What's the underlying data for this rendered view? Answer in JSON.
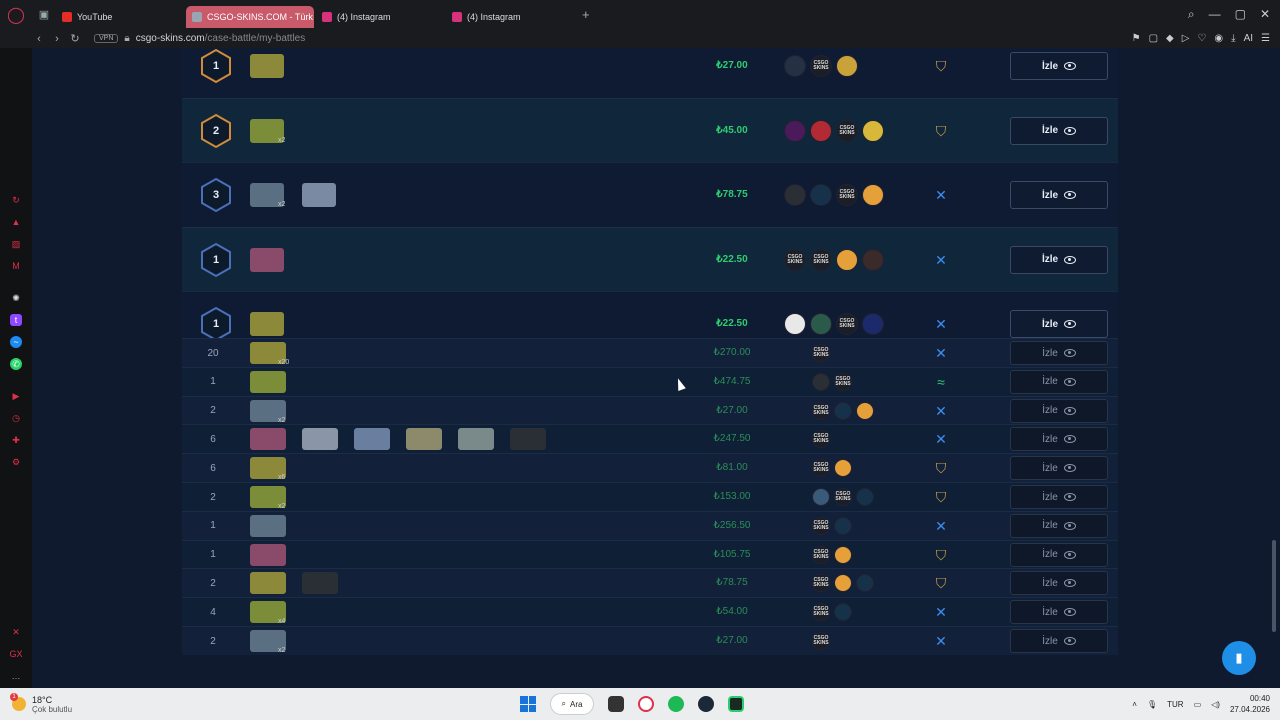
{
  "browser": {
    "tabs": [
      {
        "label": "YouTube",
        "fav": "#e52d27"
      },
      {
        "label": "CSGO-SKINS.COM - Türk",
        "fav": "#9aa5b4",
        "active": true
      },
      {
        "label": "(4) Instagram",
        "fav": "#d8327a"
      },
      {
        "label": "(4) Instagram",
        "fav": "#d8327a"
      }
    ],
    "vpn": "VPN",
    "url_host": "csgo-skins.com",
    "url_path": "/case-battle/my-battles",
    "ai_label": "AI"
  },
  "battles": {
    "button_label": "İzle",
    "featured": [
      {
        "level": "1",
        "price": "₺27.00",
        "mult": "",
        "mode": "gold",
        "avatars": [
          "#243043",
          "CSGO SKINS",
          "#c9a33a"
        ]
      },
      {
        "level": "2",
        "price": "₺45.00",
        "mult": "x2",
        "mode": "gold",
        "avatars": [
          "#4a1a5a",
          "#b22a33",
          "CSGO SKINS",
          "#d8b83a"
        ]
      },
      {
        "level": "3",
        "price": "₺78.75",
        "mult": "x2",
        "mode": "blue",
        "avatars": [
          "#2a2f36",
          "#16324a",
          "CSGO SKINS",
          "#e6a03a"
        ]
      },
      {
        "level": "1",
        "price": "₺22.50",
        "mult": "",
        "mode": "blue",
        "avatars": [
          "CSGO SKINS",
          "CSGO SKINS",
          "#e6a03a",
          "#3a2a2a"
        ]
      },
      {
        "level": "1",
        "price": "₺22.50",
        "mult": "",
        "mode": "blue",
        "avatars": [
          "#e8e8e8",
          "#2a5a4a",
          "CSGO SKINS",
          "#1a2a6a"
        ]
      }
    ],
    "compact": [
      {
        "level": "20",
        "price": "₺270.00",
        "mult": "x20",
        "mode": "blue",
        "avatars": [
          "CSGO SKINS"
        ]
      },
      {
        "level": "1",
        "price": "₺474.75",
        "mult": "",
        "mode": "green",
        "avatars": [
          "#2a2f36",
          "CSGO SKINS"
        ]
      },
      {
        "level": "2",
        "price": "₺27.00",
        "mult": "x2",
        "mode": "blue",
        "avatars": [
          "CSGO SKINS",
          "#16324a",
          "#e6a03a"
        ]
      },
      {
        "level": "6",
        "price": "₺247.50",
        "mult": "",
        "mode": "blue",
        "avatars": [
          "CSGO SKINS"
        ]
      },
      {
        "level": "6",
        "price": "₺81.00",
        "mult": "x6",
        "mode": "gold",
        "avatars": [
          "CSGO SKINS",
          "#e6a03a"
        ]
      },
      {
        "level": "2",
        "price": "₺153.00",
        "mult": "x2",
        "mode": "gold",
        "avatars": [
          "#3a5a7a",
          "CSGO SKINS",
          "#16324a"
        ]
      },
      {
        "level": "1",
        "price": "₺256.50",
        "mult": "",
        "mode": "blue",
        "avatars": [
          "CSGO SKINS",
          "#16324a"
        ]
      },
      {
        "level": "1",
        "price": "₺105.75",
        "mult": "",
        "mode": "gold",
        "avatars": [
          "CSGO SKINS",
          "#e6a03a"
        ]
      },
      {
        "level": "2",
        "price": "₺78.75",
        "mult": "",
        "mode": "gold",
        "avatars": [
          "CSGO SKINS",
          "#e6a03a",
          "#16324a"
        ]
      },
      {
        "level": "4",
        "price": "₺54.00",
        "mult": "x4",
        "mode": "blue",
        "avatars": [
          "CSGO SKINS",
          "#16324a"
        ]
      },
      {
        "level": "2",
        "price": "₺27.00",
        "mult": "x2",
        "mode": "blue",
        "avatars": [
          "CSGO SKINS"
        ]
      }
    ]
  },
  "taskbar": {
    "temp": "18°C",
    "weather": "Çok bulutlu",
    "search": "Ara",
    "lang": "TUR",
    "time": "00:40",
    "date": "27.04.2026",
    "notif": "1"
  }
}
